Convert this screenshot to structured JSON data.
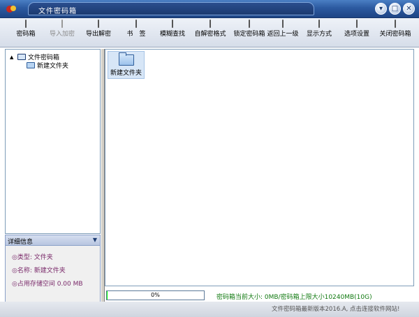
{
  "window": {
    "title": "文件密码箱",
    "controls": [
      "▾",
      "□",
      "✕"
    ]
  },
  "toolbar": {
    "items": [
      {
        "label": "密码箱",
        "icon": "safe-icon",
        "enabled": true
      },
      {
        "label": "导入加密",
        "icon": "import-encrypt-icon",
        "enabled": false
      },
      {
        "label": "导出解密",
        "icon": "export-decrypt-icon",
        "enabled": true
      },
      {
        "label": "书　签",
        "icon": "bookmark-icon",
        "enabled": true
      },
      {
        "label": "模糊查找",
        "icon": "search-icon",
        "enabled": true
      },
      {
        "label": "自解密格式",
        "icon": "self-decrypt-icon",
        "enabled": true
      },
      {
        "label": "锁定密码箱",
        "icon": "key-icon",
        "enabled": true
      },
      {
        "label": "返回上一级",
        "icon": "up-arrow-icon",
        "enabled": true
      },
      {
        "label": "显示方式",
        "icon": "view-mode-icon",
        "enabled": true
      },
      {
        "label": "选项设置",
        "icon": "settings-icon",
        "enabled": true
      },
      {
        "label": "关闭密码箱",
        "icon": "close-safe-icon",
        "enabled": true
      }
    ]
  },
  "tree": {
    "expander": "▲",
    "root_label": "文件密码箱",
    "child_label": "新建文件夹"
  },
  "details": {
    "header": "详细信息",
    "arrow": "▼",
    "rows": [
      "◎类型: 文件夹",
      "◎名称: 新建文件夹",
      "◎占用存储空间 0.00 MB"
    ]
  },
  "main": {
    "files": [
      {
        "label": "新建文件夹",
        "icon": "folder-icon",
        "selected": true
      }
    ]
  },
  "status": {
    "progress_text": "0%",
    "progress_value": 1,
    "size_text": "密码箱当前大小: 0MB/密码箱上限大小10240MB(10G)",
    "bottom_text": "文件密码箱最新版本2016.A, 点击连接软件网站!"
  },
  "colors": {
    "titlebar": "#2c5aa0",
    "progress": "#00ff00",
    "status_text": "#117a11",
    "detail_text": "#7a2a6a"
  }
}
